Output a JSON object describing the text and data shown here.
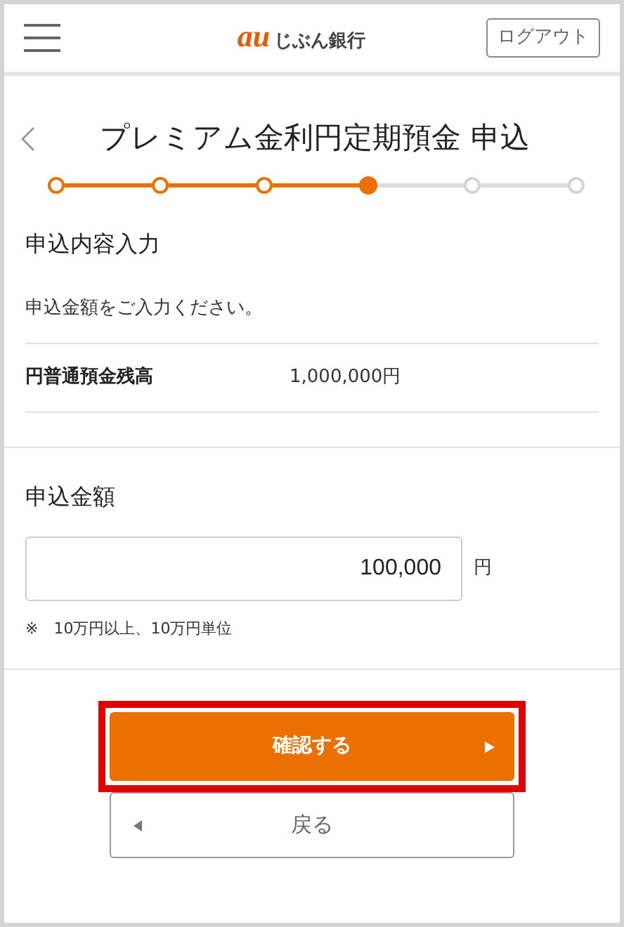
{
  "header": {
    "logo_mark": "au",
    "logo_text": "じぶん銀行",
    "logout_button": "ログアウト"
  },
  "page_title": "プレミアム金利円定期預金 申込",
  "steps": [
    {
      "kind": "done"
    },
    {
      "kind": "done"
    },
    {
      "kind": "done"
    },
    {
      "kind": "current"
    },
    {
      "kind": "todo"
    },
    {
      "kind": "todo"
    }
  ],
  "section_title": "申込内容入力",
  "instruction": "申込金額をご入力ください。",
  "balance": {
    "label": "円普通預金残高",
    "value": "1,000,000円"
  },
  "amount": {
    "label": "申込金額",
    "value": "100,000",
    "unit": "円",
    "note": "※　10万円以上、10万円単位"
  },
  "confirm_button": {
    "label": "確認する",
    "highlighted": true
  },
  "back_button": "戻る"
}
